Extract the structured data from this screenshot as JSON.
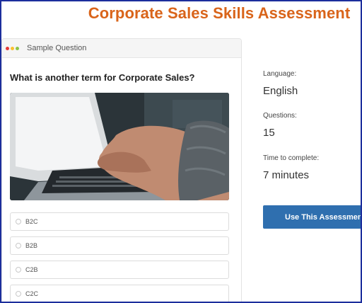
{
  "page": {
    "title": "Corporate Sales Skills Assessment"
  },
  "sample": {
    "header_label": "Sample Question",
    "window_dots": [
      "#e53935",
      "#fbc02d",
      "#8bc34a"
    ],
    "question": "What is another term for Corporate Sales?",
    "image_alt": "laptop-typing-photo",
    "options": [
      "B2C",
      "B2B",
      "C2B",
      "C2C"
    ]
  },
  "details": {
    "language_label": "Language:",
    "language_value": "English",
    "questions_label": "Questions:",
    "questions_value": "15",
    "time_label": "Time to complete:",
    "time_value": "7 minutes"
  },
  "cta": {
    "label": "Use This Assessment"
  },
  "colors": {
    "title": "#d9641a",
    "button": "#2f6faf",
    "frame": "#1c2e9c"
  }
}
